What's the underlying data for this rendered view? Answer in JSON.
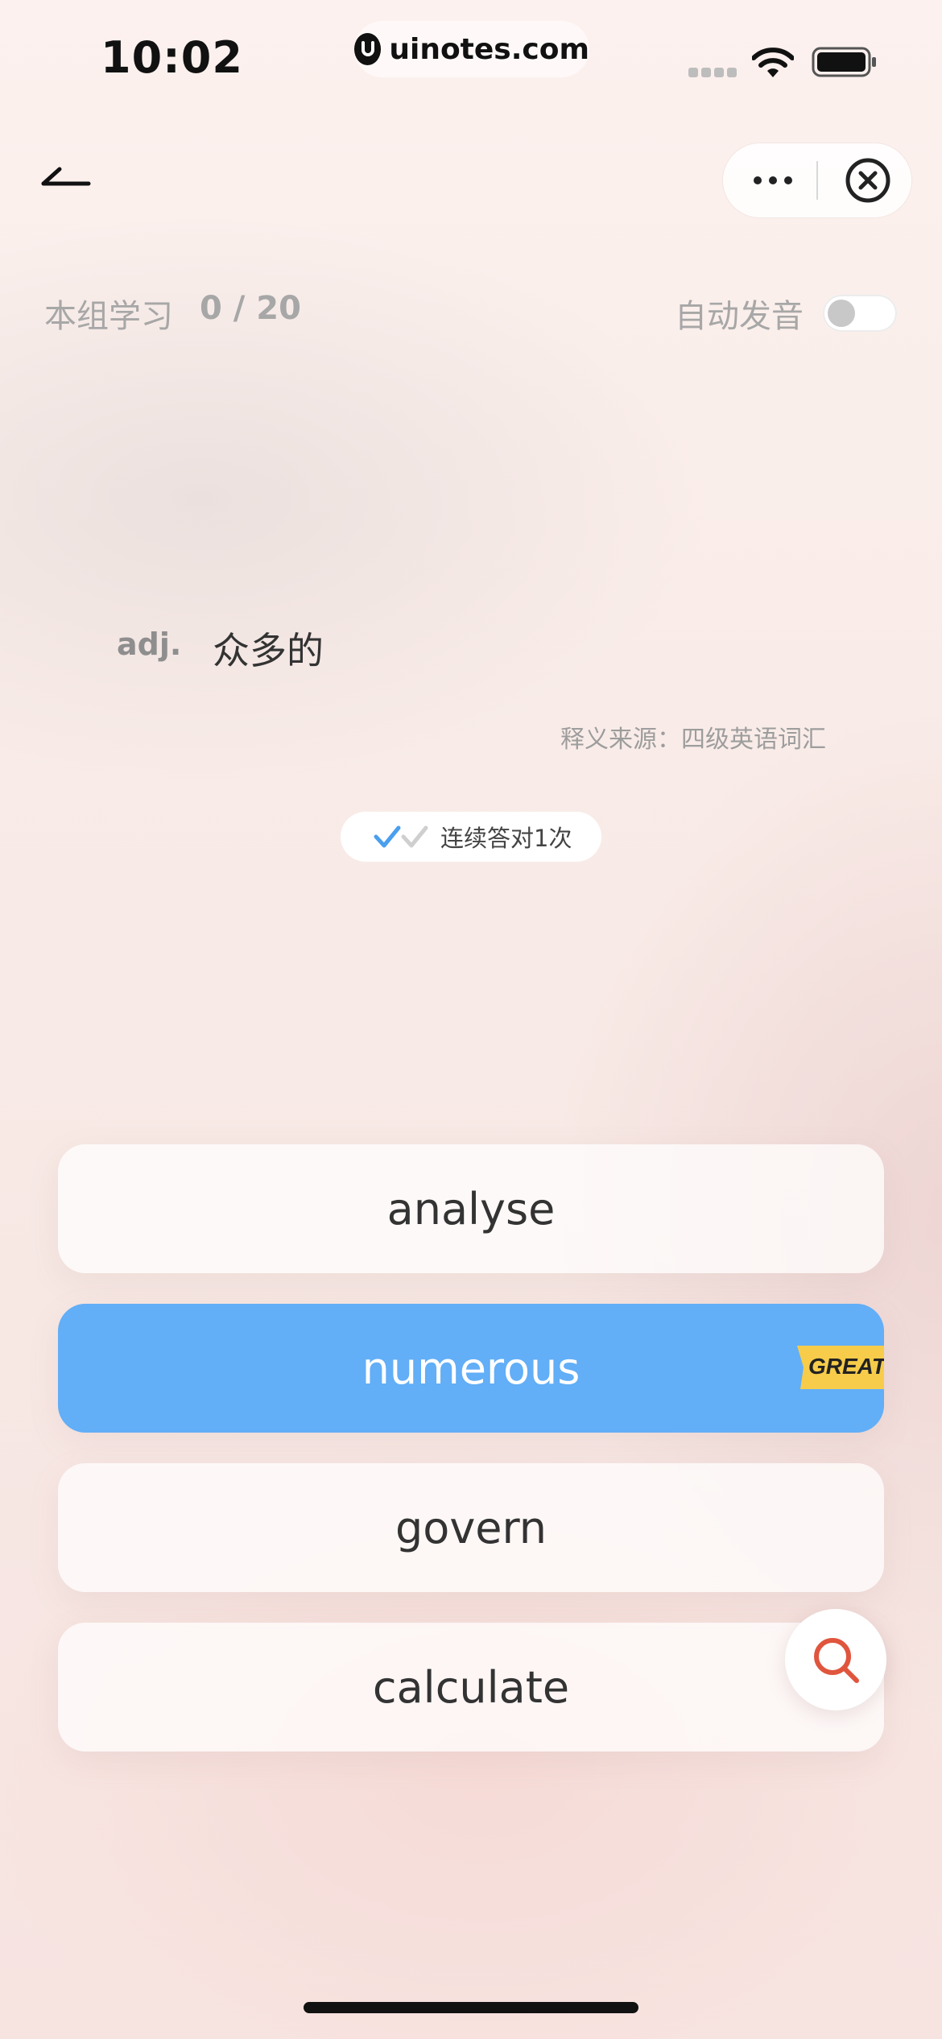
{
  "status_bar": {
    "time": "10:02",
    "site": "uinotes.com"
  },
  "progress": {
    "label": "本组学习",
    "count": "0 / 20"
  },
  "autoplay": {
    "label": "自动发音",
    "enabled": false
  },
  "definition": {
    "pos": "adj.",
    "meaning": "众多的",
    "source": "释义来源：四级英语词汇"
  },
  "streak": {
    "text": "连续答对1次"
  },
  "options": [
    {
      "label": "analyse",
      "state": "default"
    },
    {
      "label": "numerous",
      "state": "correct"
    },
    {
      "label": "govern",
      "state": "default"
    },
    {
      "label": "calculate",
      "state": "default"
    }
  ],
  "badge": {
    "text": "GREAT!"
  },
  "colors": {
    "accent_blue": "#62aef7",
    "badge_yellow": "#f6cc4a",
    "search_red": "#e0553d"
  },
  "icons": {
    "back": "back-arrow-icon",
    "more": "more-dots-icon",
    "close": "close-circle-icon",
    "search": "search-icon"
  }
}
